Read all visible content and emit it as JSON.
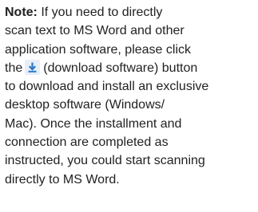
{
  "note": {
    "label": "Note:",
    "line1": " If you need to directly",
    "line2": "scan text to MS Word and other",
    "line3": "application software, please click",
    "line4_pre": "the",
    "line4_post": "(download software) button",
    "line5": "to download and install an exclusive",
    "line6": "desktop software (Windows/",
    "line7": "Mac). Once the installment and",
    "line8": "connection are completed as",
    "line9": "instructed, you could start scanning",
    "line10": "directly to MS Word."
  },
  "icons": {
    "download": "download-icon"
  },
  "colors": {
    "text": "#222222",
    "icon_accent": "#2f78c8",
    "icon_bg": "#e6eef8"
  }
}
